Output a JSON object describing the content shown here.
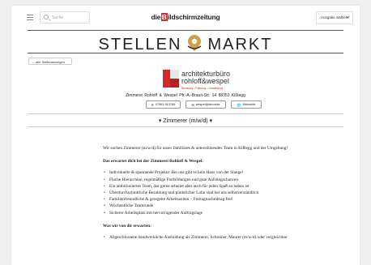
{
  "header": {
    "search_placeholder": "Suche",
    "logo_prefix": "die",
    "logo_b": "B",
    "logo_suffix": "ildschirmzeitung",
    "edition_label": "Ausgabe wählen"
  },
  "stellenmarkt": {
    "left": "STELLEN",
    "right": "MARKT"
  },
  "back_label": "←  alle Stellenanzeigen",
  "company": {
    "name_line1": "architekturbüro",
    "name_line2": "rohloff&wespel",
    "tagline": "Beratung • Planung • Umsetzung",
    "address": "Zimmerei Rohloff & Wespel   Pfr.-A.-Braun-Str. 14   88353 Kißlegg",
    "phone": "07563-913766",
    "email": "wespel@alnovide",
    "website": "Webseite"
  },
  "job_title": "Zimmerer (m/w/d)",
  "content": {
    "intro": "Wir suchen Zimmerer (m/w/d) für unser familiäres & unterstützendes Team in Kißlegg und der Umgebung!",
    "heading1": "Das erwartet dich bei der Zimmerei Rohloff & Wespel:",
    "benefits": [
      "Individuelle & spannende Projekte: Bei uns gibt es kein Haus von der Stange!",
      "Flache Hierarchien, regelmäßige Fortbildungen und gute Aufstiegschancen",
      "Ein ambitioniertes Team, das gerne arbeitet aber auch für jeden Spaß zu haben ist",
      "Überdurchschnittliche Bezahlung und pünktlicher Lohn sind bei uns selbstverständlich",
      "Familienfreundliche & geregelte Arbeitszeiten – Freitagnachmittag frei!",
      "Wöchentliche Teamrunde",
      "Sicherer Arbeitsplatz mit hervorragender Auftragslage"
    ],
    "heading2": "Was wir von dir erwarten:",
    "requirements": [
      "Abgeschlossene handwerkliche Ausbildung als Zimmerer, Schreiner, Maurer (m/w/d) oder vergleichbar"
    ]
  },
  "colors": {
    "brand_red": "#d7262c",
    "map_pin_gold": "#c9a24a"
  }
}
